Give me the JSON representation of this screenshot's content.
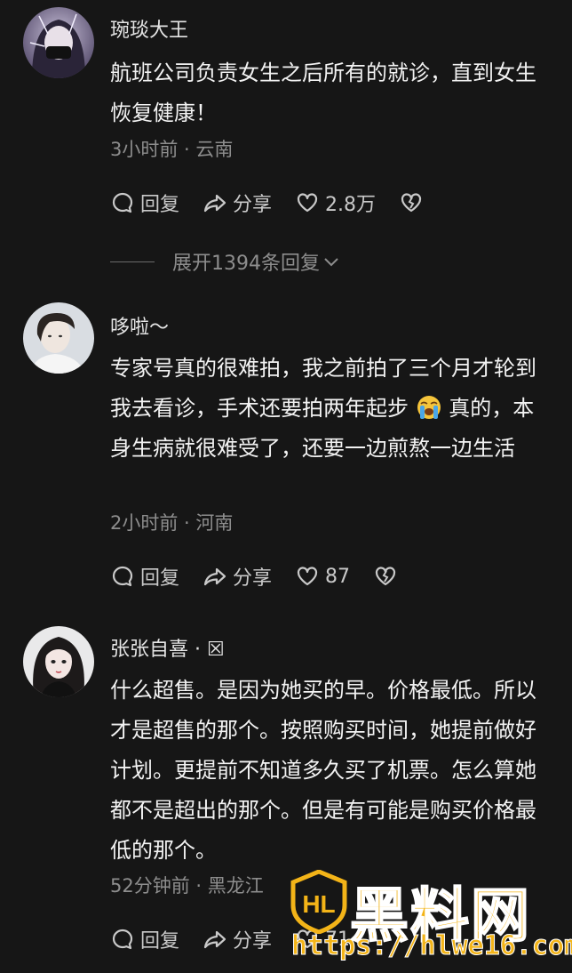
{
  "comments": [
    {
      "username": "琬琰大王",
      "text": "航班公司负责女生之后所有的就诊，直到女生恢复健康！",
      "time": "3小时前",
      "location": "云南",
      "reply_label": "回复",
      "share_label": "分享",
      "likes": "2.8万"
    },
    {
      "username": "哆啦～",
      "text_before_emoji": "专家号真的很难拍，我之前拍了三个月才轮到我去看诊，手术还要拍两年起步",
      "emoji": "loudly-crying-face",
      "text_after_emoji": " 真的，本身生病就很难受了，还要一边煎熬一边生活",
      "time": "2小时前",
      "location": "河南",
      "reply_label": "回复",
      "share_label": "分享",
      "likes": "87"
    },
    {
      "username": "张张自喜 · ☒",
      "text": "什么超售。是因为她买的早。价格最低。所以才是超售的那个。按照购买时间，她提前做好计划。更提前不知道多久买了机票。怎么算她都不是超出的那个。但是有可能是购买价格最低的那个。",
      "time": "52分钟前",
      "location": "黑龙江",
      "reply_label": "回复",
      "share_label": "分享",
      "likes": "71"
    }
  ],
  "expand_replies": "展开1394条回复",
  "meta_separator": " · ",
  "watermark": {
    "logo_text": "HL",
    "title": "黑料网",
    "url": "https://hlwe16.com",
    "color": "#f3b418"
  },
  "colors": {
    "background": "#161616",
    "meta": "#8d8d8d"
  }
}
